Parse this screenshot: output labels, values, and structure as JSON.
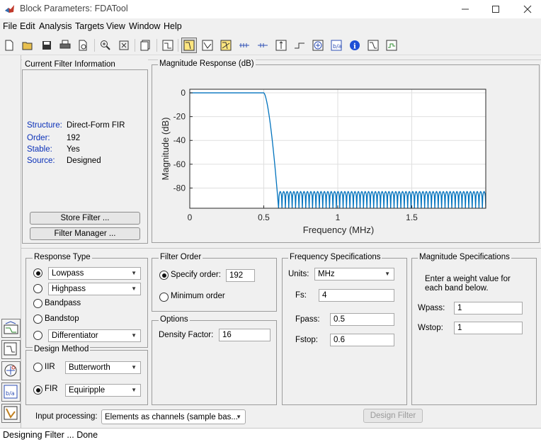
{
  "window": {
    "title": "Block Parameters: FDATool",
    "controls": [
      "minimize",
      "maximize",
      "close"
    ]
  },
  "menubar": [
    "File",
    "Edit",
    "Analysis",
    "Targets",
    "View",
    "Window",
    "Help"
  ],
  "toolbar": {
    "icons": [
      "new-icon",
      "open-icon",
      "save-icon",
      "print-icon",
      "print-preview-icon",
      "zoom-in-icon",
      "zoom-full-icon",
      "new-figure-icon",
      "filter-specs-icon",
      "magnitude-response-icon",
      "phase-response-icon",
      "magnitude-phase-icon",
      "group-delay-icon",
      "phase-delay-icon",
      "impulse-response-icon",
      "step-response-icon",
      "pole-zero-icon",
      "filter-coefficients-icon",
      "filter-info-icon",
      "magnitude-estimate-icon",
      "noise-psd-icon"
    ],
    "active": "magnitude-response-icon"
  },
  "filter_info": {
    "legend": "Current Filter Information",
    "rows": [
      {
        "key": "Structure:",
        "value": "Direct-Form FIR"
      },
      {
        "key": "Order:",
        "value": "192"
      },
      {
        "key": "Stable:",
        "value": "Yes"
      },
      {
        "key": "Source:",
        "value": "Designed"
      }
    ],
    "store_button": "Store Filter ...",
    "manager_button": "Filter Manager ..."
  },
  "chart_data": {
    "type": "line",
    "panel_title": "Magnitude Response (dB)",
    "xlabel": "Frequency (MHz)",
    "ylabel": "Magnitude (dB)",
    "xlim": [
      0,
      2
    ],
    "ylim": [
      -97,
      3
    ],
    "xticks": [
      0,
      0.5,
      1,
      1.5
    ],
    "xtick_labels": [
      "0",
      "0.5",
      "1",
      "1.5"
    ],
    "yticks": [
      0,
      -20,
      -40,
      -60,
      -80
    ],
    "ytick_labels": [
      "0",
      "-20",
      "-40",
      "-60",
      "-80"
    ],
    "grid": true,
    "series": [
      {
        "color": "#0072bd",
        "passband": {
          "x": [
            0,
            0.5
          ],
          "y": 0
        },
        "transition": {
          "x": [
            0.5,
            0.6
          ],
          "y": [
            0,
            -97
          ]
        },
        "stopband": {
          "x": [
            0.6,
            2
          ],
          "ripple_peak": -83,
          "ripple_floor": -97,
          "lobes": 61
        }
      }
    ]
  },
  "response_type": {
    "legend": "Response Type",
    "options": [
      {
        "label": "Lowpass",
        "selected": true,
        "dropdown": true
      },
      {
        "label": "Highpass",
        "selected": false,
        "dropdown": true
      },
      {
        "label": "Bandpass",
        "selected": false,
        "dropdown": false
      },
      {
        "label": "Bandstop",
        "selected": false,
        "dropdown": false
      },
      {
        "label": "Differentiator",
        "selected": false,
        "dropdown": true
      }
    ]
  },
  "design_method": {
    "legend": "Design Method",
    "iir_label": "IIR",
    "iir_value": "Butterworth",
    "fir_label": "FIR",
    "fir_value": "Equiripple",
    "selected": "FIR"
  },
  "filter_order": {
    "legend": "Filter Order",
    "specify_label": "Specify order:",
    "specify_value": "192",
    "minimum_label": "Minimum order",
    "selected": "specify"
  },
  "options": {
    "legend": "Options",
    "density_label": "Density Factor:",
    "density_value": "16"
  },
  "freq_specs": {
    "legend": "Frequency Specifications",
    "units_label": "Units:",
    "units_value": "MHz",
    "fs_label": "Fs:",
    "fs_value": "4",
    "fpass_label": "Fpass:",
    "fpass_value": "0.5",
    "fstop_label": "Fstop:",
    "fstop_value": "0.6"
  },
  "mag_specs": {
    "legend": "Magnitude Specifications",
    "note": "Enter a weight value for each band below.",
    "wpass_label": "Wpass:",
    "wpass_value": "1",
    "wstop_label": "Wstop:",
    "wstop_value": "1"
  },
  "bottom": {
    "input_processing_label": "Input processing:",
    "input_processing_value": "Elements as channels (sample bas...",
    "design_button": "Design Filter"
  },
  "status": "Designing Filter ... Done"
}
